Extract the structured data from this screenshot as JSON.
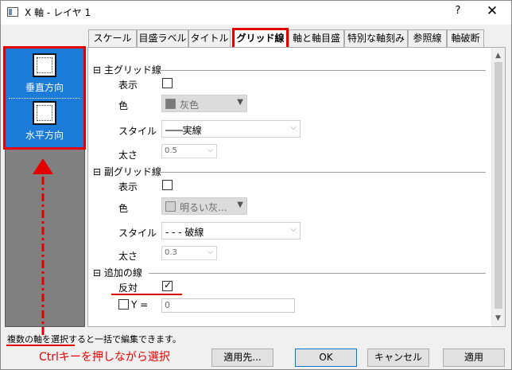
{
  "window": {
    "title": "X 軸 - レイヤ 1",
    "help_label": "?",
    "close_label": "✕"
  },
  "axes": [
    {
      "label": "垂直方向",
      "icon": "vertical-axis-icon"
    },
    {
      "label": "水平方向",
      "icon": "horizontal-axis-icon"
    }
  ],
  "tabs": [
    {
      "label": "スケール",
      "active": false
    },
    {
      "label": "目盛ラベル",
      "active": false
    },
    {
      "label": "タイトル",
      "active": false
    },
    {
      "label": "グリッド線",
      "active": true
    },
    {
      "label": "軸と軸目盛",
      "active": false
    },
    {
      "label": "特別な軸刻み",
      "active": false
    },
    {
      "label": "参照線",
      "active": false
    },
    {
      "label": "軸破断",
      "active": false
    }
  ],
  "major": {
    "title": "主グリッド線",
    "show_label": "表示",
    "show_checked": false,
    "color_label": "色",
    "color_value": "灰色",
    "style_label": "スタイル",
    "style_value": "───実線",
    "thickness_label": "太さ",
    "thickness_value": "0.5"
  },
  "minor": {
    "title": "副グリッド線",
    "show_label": "表示",
    "show_checked": false,
    "color_label": "色",
    "color_value": "明るい灰...",
    "style_label": "スタイル",
    "style_value": "- - - 破線",
    "thickness_label": "太さ",
    "thickness_value": "0.3"
  },
  "extra": {
    "title": "追加の線",
    "opposite_label": "反対",
    "opposite_checked": true,
    "y_label": "Y =",
    "y_value": "0"
  },
  "collapse_glyph": "⊟",
  "hint_text": "複数の軸を選択すると一括で編集できます。",
  "annotation": "Ctrlキーを押しながら選択",
  "buttons": {
    "apply_to": "適用先...",
    "ok": "OK",
    "cancel": "キャンセル",
    "apply": "適用"
  },
  "colors": {
    "highlight": "#e50000",
    "selection": "#1a7bd8"
  }
}
